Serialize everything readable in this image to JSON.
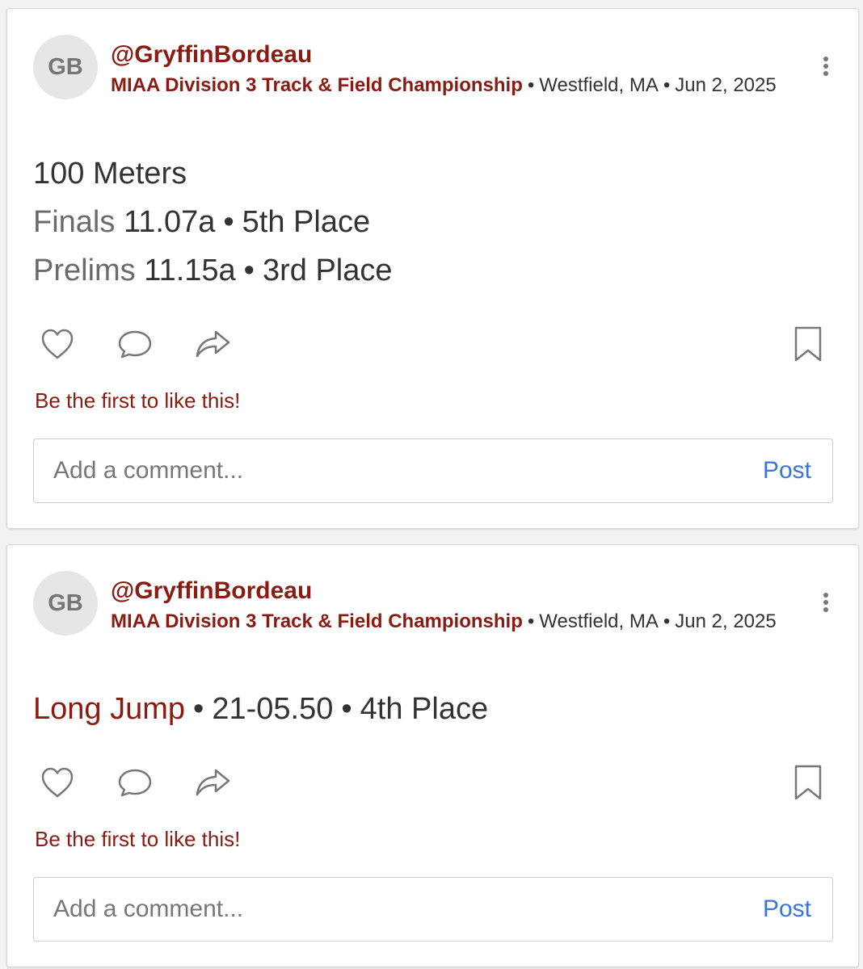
{
  "posts": [
    {
      "avatar_initials": "GB",
      "username": "@GryffinBordeau",
      "event_name": "MIAA Division 3 Track & Field Championship",
      "location": "Westfield, MA",
      "date": "Jun 2, 2025",
      "title": "100 Meters",
      "results": [
        {
          "round": "Finals",
          "mark": "11.07a",
          "place": "5th Place"
        },
        {
          "round": "Prelims",
          "mark": "11.15a",
          "place": "3rd Place"
        }
      ],
      "likes_text": "Be the first to like this!",
      "comment_placeholder": "Add a comment...",
      "post_label": "Post"
    },
    {
      "avatar_initials": "GB",
      "username": "@GryffinBordeau",
      "event_name": "MIAA Division 3 Track & Field Championship",
      "location": "Westfield, MA",
      "date": "Jun 2, 2025",
      "title": "Long Jump",
      "mark": "21-05.50",
      "place": "4th Place",
      "likes_text": "Be the first to like this!",
      "comment_placeholder": "Add a comment...",
      "post_label": "Post"
    }
  ],
  "separator": "•",
  "icons": [
    "heart-icon",
    "comment-icon",
    "share-icon",
    "bookmark-icon",
    "more-options-icon"
  ],
  "colors": {
    "accent": "#8b1a10",
    "link": "#3a76d6",
    "text": "#333333"
  }
}
